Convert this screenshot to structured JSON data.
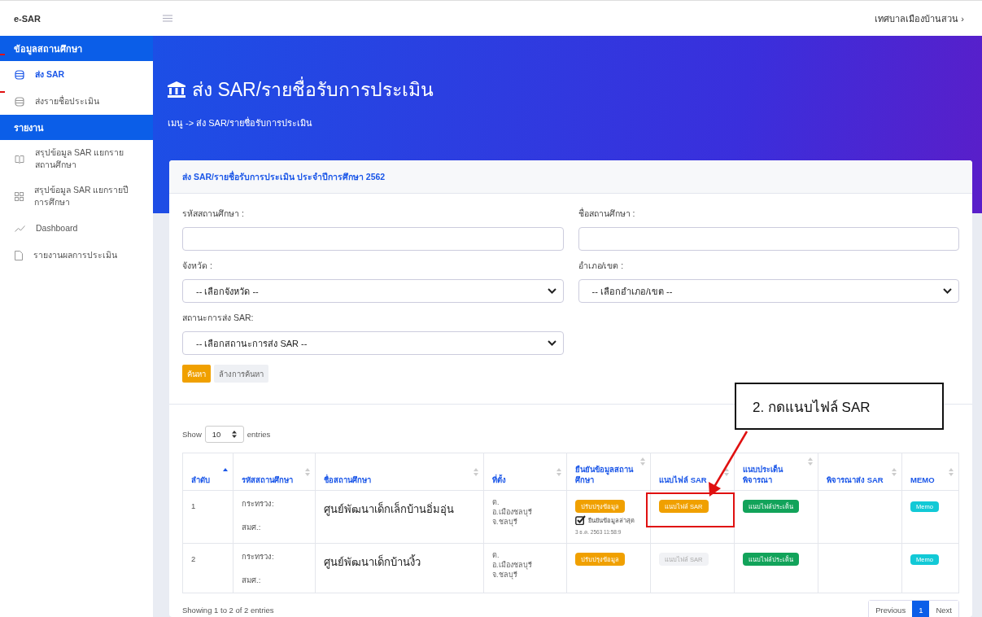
{
  "brand": "e-SAR",
  "topbar": {
    "user": "เทศบาลเมืองบ้านสวน",
    "caret": "›"
  },
  "sidebar": [
    {
      "header": "ข้อมูลสถานศึกษา",
      "items": [
        {
          "label": "ส่ง SAR",
          "kind": "database",
          "selected": true
        },
        {
          "label": "ส่งรายชื่อประเมิน",
          "kind": "database",
          "selected": false
        }
      ]
    },
    {
      "header": "รายงาน",
      "items": [
        {
          "label": "สรุปข้อมูล SAR แยกรายสถานศึกษา",
          "kind": "book",
          "selected": false
        },
        {
          "label": "สรุปข้อมูล SAR แยกรายปีการศึกษา",
          "kind": "grid",
          "selected": false
        },
        {
          "label": "Dashboard",
          "kind": "chart",
          "selected": false
        },
        {
          "label": "รายงานผลการประเมิน",
          "kind": "file",
          "selected": false
        }
      ]
    }
  ],
  "banner": {
    "title": "ส่ง SAR/รายชื่อรับการประเมิน",
    "breadcrumb": "เมนู -> ส่ง SAR/รายชื่อรับการประเมิน"
  },
  "card": {
    "title": "ส่ง SAR/รายชื่อรับการประเมิน ประจำปีการศึกษา 2562",
    "fields": [
      {
        "label": "รหัสสถานศึกษา :",
        "kind": "text"
      },
      {
        "label": "ชื่อสถานศึกษา :",
        "kind": "text"
      },
      {
        "label": "จังหวัด :",
        "kind": "select",
        "value": "-- เลือกจังหวัด --"
      },
      {
        "label": "อำเภอ/เขต :",
        "kind": "select",
        "value": "-- เลือกอำเภอ/เขต --"
      },
      {
        "label": "สถานะการส่ง SAR:",
        "kind": "select",
        "value": "-- เลือกสถานะการส่ง SAR --"
      }
    ],
    "buttons": [
      {
        "label": "ค้นหา",
        "kind": "primary"
      },
      {
        "label": "ล้างการค้นหา",
        "kind": "secondary"
      }
    ]
  },
  "table": {
    "length": {
      "before": "Show",
      "value": "10",
      "after": "entries"
    },
    "columns": [
      {
        "label": "ลำดับ",
        "sorted": true
      },
      {
        "label": "รหัสสถานศึกษา",
        "sorted": false
      },
      {
        "label": "ชื่อสถานศึกษา",
        "sorted": false
      },
      {
        "label": "ที่ตั้ง",
        "sorted": false
      },
      {
        "label": "ยืนยันข้อมูลสถานศึกษา",
        "sorted": false
      },
      {
        "label": "แนบไฟล์ SAR",
        "sorted": false
      },
      {
        "label": "แนบประเด็นพิจารณา",
        "sorted": false
      },
      {
        "label": "พิจารณาส่ง SAR",
        "sorted": false
      },
      {
        "label": "MEMO",
        "sorted": false
      }
    ],
    "rows": [
      {
        "index": "1",
        "code": [
          "กระทรวง:",
          "สมศ.:"
        ],
        "name": "ศูนย์พัฒนาเด็กเล็กบ้านอิ่มอุ่น",
        "location": [
          "ต.",
          "อ.เมืองชลบุรี",
          "จ.ชลบุรี"
        ],
        "update_button": "ปรับปรุงข้อมูล",
        "confirmed": {
          "checked": true,
          "label": "ยืนยันข้อมูลล่าสุด",
          "time": "3 ธ.ค. 2563 11:58:9"
        },
        "sar_button": {
          "label": "แนบไฟล์ SAR",
          "enabled": true
        },
        "issue_button": "แนบไฟล์ประเด็น",
        "memo_button": "Memo"
      },
      {
        "index": "2",
        "code": [
          "กระทรวง:",
          "สมศ.:"
        ],
        "name": "ศูนย์พัฒนาเด็กบ้านงิ้ว",
        "location": [
          "ต.",
          "อ.เมืองชลบุรี",
          "จ.ชลบุรี"
        ],
        "update_button": "ปรับปรุงข้อมูล",
        "sar_button": {
          "label": "แนบไฟล์ SAR",
          "enabled": false
        },
        "issue_button": "แนบไฟล์ประเด็น",
        "memo_button": "Memo"
      }
    ],
    "info": "Showing 1 to 2 of 2 entries",
    "pagination": [
      {
        "label": "Previous",
        "selected": false
      },
      {
        "label": "1",
        "selected": true
      },
      {
        "label": "Next",
        "selected": false
      }
    ]
  },
  "annotation": {
    "text": "2. กดแนบไฟล์ SAR"
  }
}
